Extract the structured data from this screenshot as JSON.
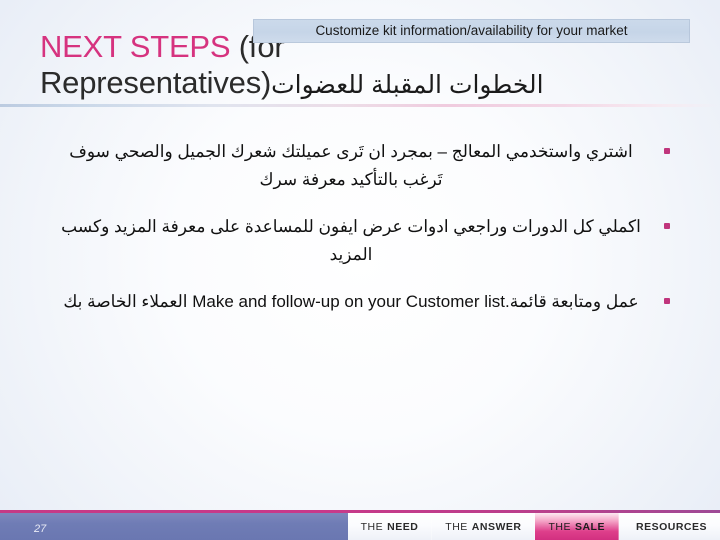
{
  "slide": {
    "page_number": "27",
    "accent_pink": "#d6337f",
    "bullet_color": "#c0357c",
    "footer_bar_color": "#6f7cb5",
    "footer_rule_color": "#c53a86",
    "callout_bg": "#c6d5e8"
  },
  "header": {
    "title_line1_pink": "NEXT STEPS",
    "title_line1_rest": " (for",
    "title_line2_rest": "Representatives)",
    "title_arabic": "الخطوات المقبلة للعضوات",
    "callout_text": "Customize kit information/availability for your market"
  },
  "body": {
    "bullets": [
      {
        "id": "bullet-1",
        "text": "اشتري واستخدمي المعالج – بمجرد ان تَرى عميلتك شعرك الجميل والصحي سوف تَرغب بالتأكيد معرفة سرك"
      },
      {
        "id": "bullet-2",
        "text": "اكملي كل الدورات وراجعي ادوات عرض ايفون للمساعدة على معرفة المزيد وكسب المزيد"
      },
      {
        "id": "bullet-3",
        "text_en": "Make and follow-up on your Customer list.",
        "text_ar_lead": "عمل ومتابعة قائمة",
        "text_ar_tail": "العملاء الخاصة بك"
      }
    ]
  },
  "footer": {
    "tabs": [
      {
        "lead": "THE",
        "strong": "NEED",
        "active": false
      },
      {
        "lead": "THE",
        "strong": "ANSWER",
        "active": false
      },
      {
        "lead": "THE",
        "strong": "SALE",
        "active": true
      },
      {
        "lead": "",
        "strong": "RESOURCES",
        "active": false
      }
    ]
  }
}
